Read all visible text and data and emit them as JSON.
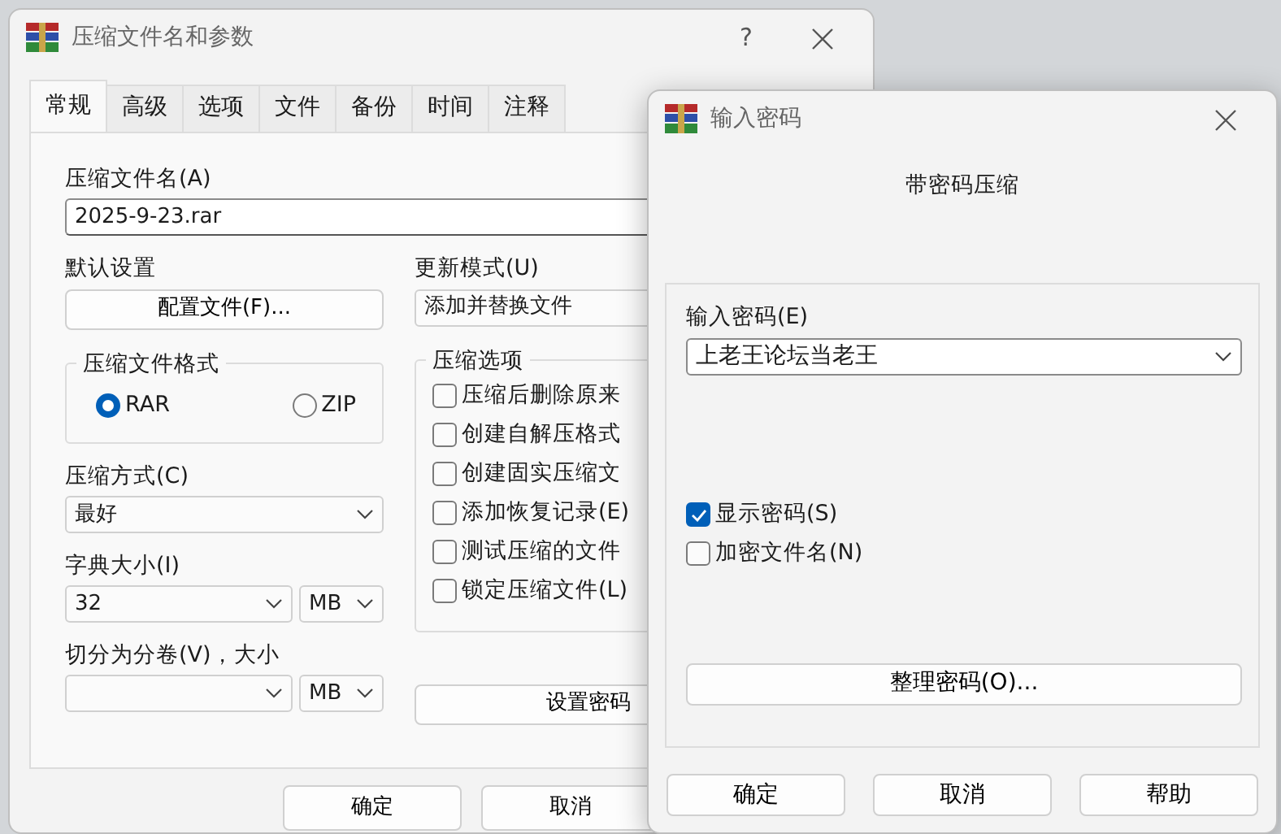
{
  "main_window": {
    "title": "压缩文件名和参数",
    "help_button": "?",
    "tabs": [
      {
        "label": "常规",
        "selected": true
      },
      {
        "label": "高级",
        "selected": false
      },
      {
        "label": "选项",
        "selected": false
      },
      {
        "label": "文件",
        "selected": false
      },
      {
        "label": "备份",
        "selected": false
      },
      {
        "label": "时间",
        "selected": false
      },
      {
        "label": "注释",
        "selected": false
      }
    ],
    "archive_name": {
      "label": "压缩文件名(A)",
      "value": "2025-9-23.rar"
    },
    "default_settings": {
      "label": "默认设置",
      "button": "配置文件(F)..."
    },
    "update_mode": {
      "label": "更新模式(U)",
      "value": "添加并替换文件"
    },
    "archive_format": {
      "label": "压缩文件格式",
      "options": [
        {
          "label": "RAR",
          "selected": true
        },
        {
          "label": "ZIP",
          "selected": false
        }
      ]
    },
    "compression_method": {
      "label": "压缩方式(C)",
      "value": "最好"
    },
    "dictionary_size": {
      "label": "字典大小(I)",
      "value": "32",
      "unit": "MB"
    },
    "split_volumes": {
      "label": "切分为分卷(V)，大小",
      "unit": "MB"
    },
    "archive_options": {
      "label": "压缩选项",
      "items": [
        {
          "label": "压缩后删除原来",
          "checked": false
        },
        {
          "label": "创建自解压格式",
          "checked": false
        },
        {
          "label": "创建固实压缩文",
          "checked": false
        },
        {
          "label": "添加恢复记录(E)",
          "checked": false
        },
        {
          "label": "测试压缩的文件",
          "checked": false
        },
        {
          "label": "锁定压缩文件(L)",
          "checked": false
        }
      ]
    },
    "set_password_button": "设置密码",
    "buttons": [
      "确定",
      "取消"
    ]
  },
  "password_dialog": {
    "title": "输入密码",
    "heading": "带密码压缩",
    "password": {
      "label": "输入密码(E)",
      "value": "上老王论坛当老王"
    },
    "options": [
      {
        "label": "显示密码(S)",
        "checked": true
      },
      {
        "label": "加密文件名(N)",
        "checked": false
      }
    ],
    "organize_button": "整理密码(O)...",
    "buttons": [
      "确定",
      "取消",
      "帮助"
    ]
  }
}
